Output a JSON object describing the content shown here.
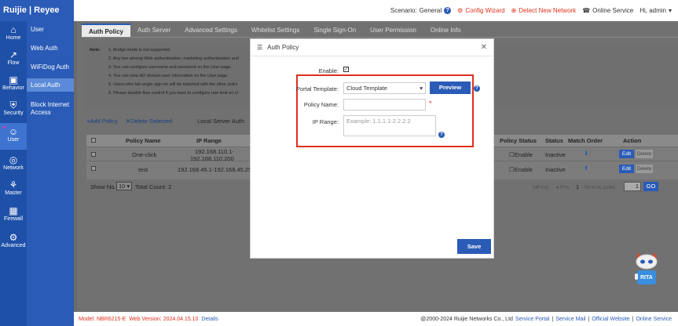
{
  "brand": {
    "logo_text": "Ruijie | Reyee"
  },
  "topbar": {
    "scenario_label": "Scenario:",
    "scenario_value": "General",
    "config_wizard": "Config Wizard",
    "detect_network": "Detect New Network",
    "online_service": "Online Service",
    "user_greeting": "Hi, admin"
  },
  "nav": [
    {
      "label": "Home",
      "icon": "home-icon"
    },
    {
      "label": "Flow",
      "icon": "flow-icon"
    },
    {
      "label": "Behavior",
      "icon": "behavior-icon"
    },
    {
      "label": "Security",
      "icon": "security-icon"
    },
    {
      "label": "User",
      "icon": "user-icon"
    },
    {
      "label": "Network",
      "icon": "network-icon"
    },
    {
      "label": "Master",
      "icon": "master-icon"
    },
    {
      "label": "Firewall",
      "icon": "firewall-icon"
    },
    {
      "label": "Advanced",
      "icon": "advanced-icon"
    }
  ],
  "subnav": [
    "User",
    "Web Auth",
    "WiFiDog Auth",
    "Local Auth",
    "Block Internet Access"
  ],
  "tabs": [
    "Auth Policy",
    "Auth Server",
    "Advanced Settings",
    "Whitelist Settings",
    "Single Sign-On",
    "User Permission",
    "Online Info"
  ],
  "notes": {
    "label": "Note:",
    "items": [
      "1. Bridge mode is not supported.",
      "2. Any two among Web authentication, marketing authentication and",
      "3. You can configure username and password on the User page.",
      "4. You can view AD domain user information on the User page.",
      "5. Users who fail single sign-on will be matched with the other polici",
      "6. Please disable flow control if you want to configure rate limit on cl"
    ]
  },
  "toolbar": {
    "add_policy": "Add Policy",
    "delete_selected": "Delete Selected",
    "local_server_auth": "Local Server Auth:"
  },
  "table": {
    "headers": [
      "Policy Name",
      "IP Range",
      "Policy Status",
      "Status",
      "Match Order",
      "Action"
    ],
    "rows": [
      {
        "name": "One-click",
        "ip_line1": "192.168.110.1-",
        "ip_line2": "192.168.110.200",
        "policy_status": "Enable",
        "status": "Inactive",
        "edit": "Edit",
        "delete": "Delete"
      },
      {
        "name": "test",
        "ip_line1": "192.168.45.1-192.168.45.25",
        "ip_line2": "",
        "policy_status": "Enable",
        "status": "Inactive",
        "edit": "Edit",
        "delete": "Delete"
      }
    ]
  },
  "pager": {
    "show_no_label": "Show No.:",
    "page_size": "10",
    "total": "Total Count: 2",
    "first": "First",
    "prev": "Pre",
    "page": "1",
    "next": "Next",
    "last": "Last",
    "goto_value": "1",
    "go": "GO"
  },
  "modal": {
    "title": "Auth Policy",
    "enable_label": "Enable:",
    "portal_template_label": "Portal Template:",
    "portal_template_value": "Cloud Template",
    "preview": "Preview",
    "policy_name_label": "Policy Name:",
    "policy_name_value": "",
    "required_mark": "*",
    "ip_range_label": "IP Range:",
    "ip_range_placeholder": "Example: 1.1.1.1-2.2.2.2",
    "save": "Save"
  },
  "footer": {
    "model_label": "Model:",
    "model_value": "NBR6215-E",
    "web_version_label": "Web Version:",
    "web_version_value": "2024.04.15.10",
    "details": "Details",
    "copyright": "@2000-2024 Ruijie Networks Co., Ltd",
    "service_portal": "Service Portal",
    "service_mail": "Service Mail",
    "official_website": "Official Website",
    "online_service": "Online Service",
    "sep": "|"
  },
  "assistant": {
    "label": "RITA"
  },
  "colors": {
    "brand_blue": "#2a5bb6",
    "accent_red": "#e0301e"
  }
}
